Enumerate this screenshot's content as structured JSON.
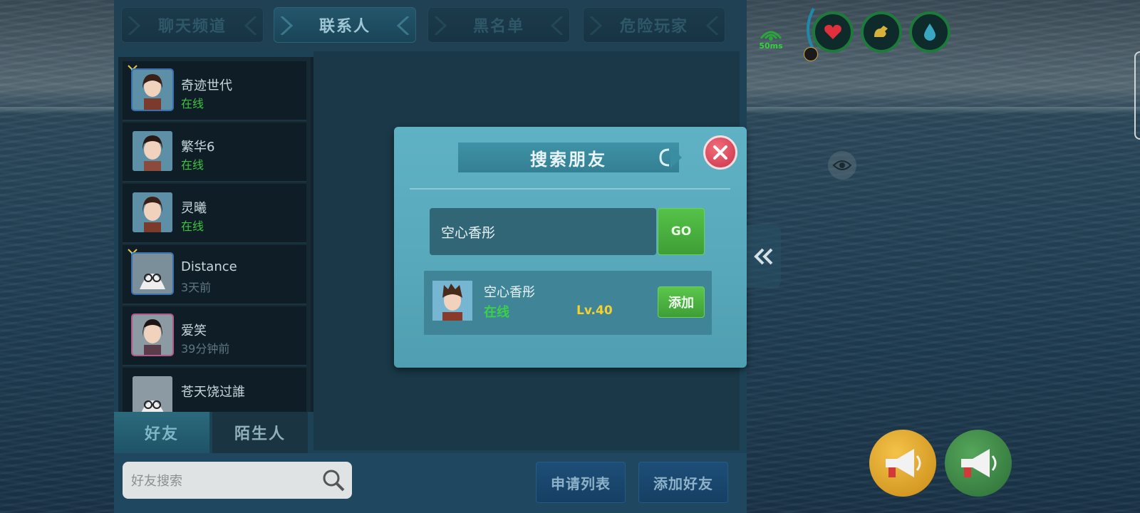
{
  "tabs": [
    {
      "label": "聊天频道",
      "active": false
    },
    {
      "label": "联系人",
      "active": true
    },
    {
      "label": "黑名单",
      "active": false
    },
    {
      "label": "危险玩家",
      "active": false
    }
  ],
  "contacts": [
    {
      "name": "奇迹世代",
      "status": "在线",
      "online": true
    },
    {
      "name": "繁华6",
      "status": "在线",
      "online": true
    },
    {
      "name": "灵曦",
      "status": "在线",
      "online": true
    },
    {
      "name": "Distance",
      "status": "3天前",
      "online": false
    },
    {
      "name": "爱笑",
      "status": "39分钟前",
      "online": false
    },
    {
      "name": "苍天饶过誰",
      "status": "",
      "online": false
    }
  ],
  "bottom_tabs": {
    "friends": "好友",
    "strangers": "陌生人"
  },
  "search": {
    "placeholder": "好友搜索"
  },
  "actions": {
    "request_list": "申请列表",
    "add_friend": "添加好友"
  },
  "modal": {
    "title": "搜索朋友",
    "input_value": "空心香彤",
    "go_label": "GO",
    "result": {
      "name": "空心香彤",
      "status": "在线",
      "level": "Lv.40",
      "add_label": "添加"
    }
  },
  "hud": {
    "ping": "50ms"
  },
  "colors": {
    "online": "#3cc441",
    "level": "#f4d12e",
    "accent": "#5fb1c4"
  }
}
